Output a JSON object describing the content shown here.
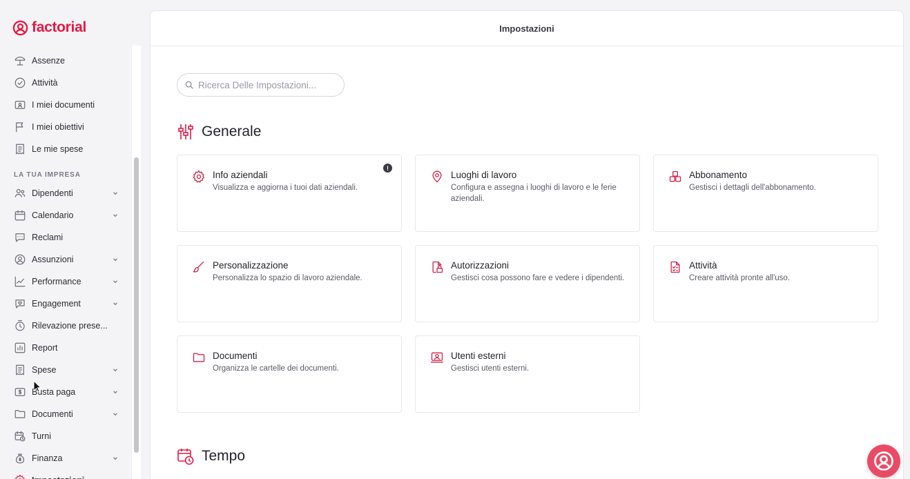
{
  "brand": {
    "name": "factorial",
    "color": "#e51943"
  },
  "sidebar": {
    "section_label": "LA TUA IMPRESA",
    "items": [
      {
        "label": "Assenze",
        "icon": "beach-umbrella-icon",
        "has_chevron": false
      },
      {
        "label": "Attività",
        "icon": "check-circle-icon",
        "has_chevron": false
      },
      {
        "label": "I miei documenti",
        "icon": "id-card-icon",
        "has_chevron": false
      },
      {
        "label": "I miei obiettivi",
        "icon": "flag-icon",
        "has_chevron": false
      },
      {
        "label": "Le mie spese",
        "icon": "receipt-icon",
        "has_chevron": false
      },
      {
        "label": "Dipendenti",
        "icon": "people-icon",
        "has_chevron": true
      },
      {
        "label": "Calendario",
        "icon": "calendar-icon",
        "has_chevron": true
      },
      {
        "label": "Reclami",
        "icon": "chat-bubble-icon",
        "has_chevron": false
      },
      {
        "label": "Assunzioni",
        "icon": "user-circle-icon",
        "has_chevron": true
      },
      {
        "label": "Performance",
        "icon": "trend-chart-icon",
        "has_chevron": true
      },
      {
        "label": "Engagement",
        "icon": "heart-bubble-icon",
        "has_chevron": true
      },
      {
        "label": "Rilevazione prese...",
        "icon": "stopwatch-icon",
        "has_chevron": false
      },
      {
        "label": "Report",
        "icon": "bar-chart-icon",
        "has_chevron": false
      },
      {
        "label": "Spese",
        "icon": "receipt-icon",
        "has_chevron": true
      },
      {
        "label": "Busta paga",
        "icon": "money-icon",
        "has_chevron": true
      },
      {
        "label": "Documenti",
        "icon": "folder-icon",
        "has_chevron": true
      },
      {
        "label": "Turni",
        "icon": "calendar-clock-icon",
        "has_chevron": false
      },
      {
        "label": "Finanza",
        "icon": "money-bag-icon",
        "has_chevron": true
      },
      {
        "label": "Impostazioni",
        "icon": "gear-icon",
        "has_chevron": false
      }
    ]
  },
  "main": {
    "title": "Impostazioni",
    "search": {
      "placeholder": "Ricerca Delle Impostazioni..."
    },
    "sections": [
      {
        "title": "Generale",
        "icon": "sliders-icon",
        "cards": [
          {
            "title": "Info aziendali",
            "desc": "Visualizza e aggiorna i tuoi dati aziendali.",
            "icon": "gear-icon",
            "alert": "!"
          },
          {
            "title": "Luoghi di lavoro",
            "desc": "Configura e assegna i luoghi di lavoro e le ferie aziendali.",
            "icon": "map-pin-icon"
          },
          {
            "title": "Abbonamento",
            "desc": "Gestisci i dettagli dell'abbonamento.",
            "icon": "boxes-icon"
          },
          {
            "title": "Personalizzazione",
            "desc": "Personalizza lo spazio di lavoro aziendale.",
            "icon": "paint-brush-icon"
          },
          {
            "title": "Autorizzazioni",
            "desc": "Gestisci cosa possono fare e vedere i dipendenti.",
            "icon": "lock-file-icon"
          },
          {
            "title": "Attività",
            "desc": "Creare attività pronte all'uso.",
            "icon": "checklist-icon"
          },
          {
            "title": "Documenti",
            "desc": "Organizza le cartelle dei documenti.",
            "icon": "folder-icon"
          },
          {
            "title": "Utenti esterni",
            "desc": "Gestisci utenti esterni.",
            "icon": "external-user-icon"
          }
        ]
      },
      {
        "title": "Tempo",
        "icon": "calendar-clock-icon",
        "cards": []
      }
    ]
  },
  "colors": {
    "accent": "#e51943",
    "card_icon": "#d1254b",
    "help_bubble": "#e94b66"
  }
}
